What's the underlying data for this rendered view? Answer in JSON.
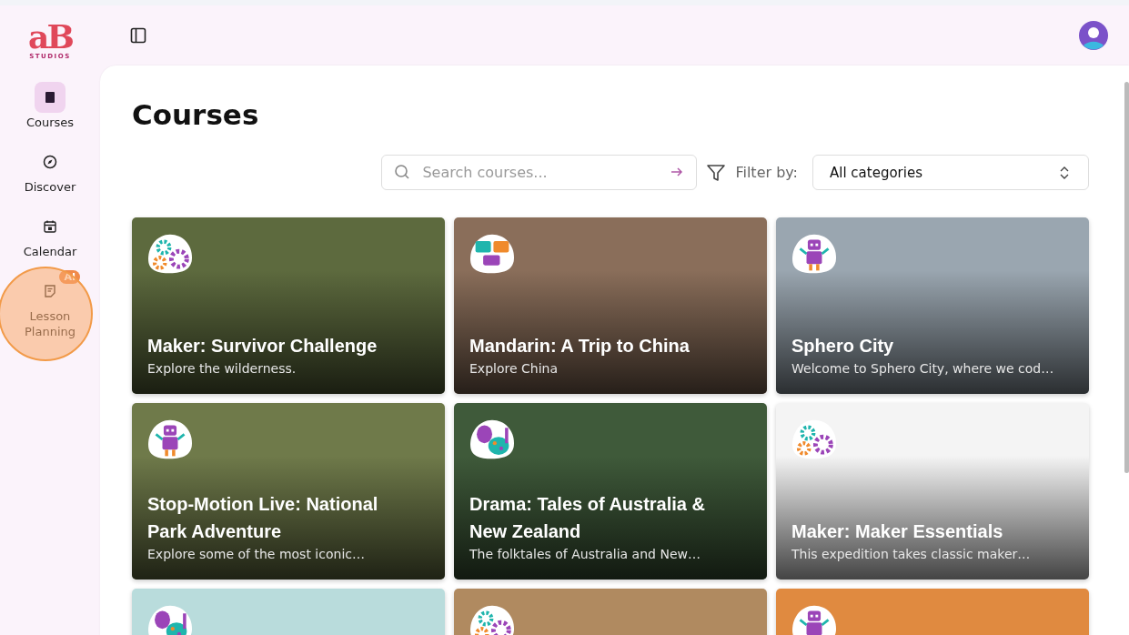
{
  "brand": {
    "logo": "aB",
    "name": "STUDIOS"
  },
  "nav": [
    {
      "label": "Courses",
      "selected": true
    },
    {
      "label": "Discover",
      "selected": false
    },
    {
      "label": "Calendar",
      "selected": false
    },
    {
      "label": "Lesson Planning",
      "selected": false,
      "badge": "AI",
      "highlighted": true
    }
  ],
  "page_title": "Courses",
  "search": {
    "placeholder": "Search courses..."
  },
  "filter": {
    "label": "Filter by:",
    "value": "All categories"
  },
  "courses": [
    {
      "title": "Maker: Survivor Challenge",
      "subtitle": "Explore the wilderness.",
      "kind": "maker"
    },
    {
      "title": "Mandarin: A Trip to China",
      "subtitle": "Explore China",
      "kind": "language"
    },
    {
      "title": "Sphero City",
      "subtitle": "Welcome to Sphero City, where we cod…",
      "kind": "coding"
    },
    {
      "title": "Stop-Motion Live: National Park Adventure",
      "subtitle": "Explore some of the most iconic…",
      "kind": "coding"
    },
    {
      "title": "Drama: Tales of Australia & New Zealand",
      "subtitle": "The folktales of Australia and New…",
      "kind": "drama"
    },
    {
      "title": "Maker: Maker Essentials",
      "subtitle": "This expedition takes classic maker…",
      "kind": "maker"
    },
    {
      "kind": "drama"
    },
    {
      "kind": "maker"
    },
    {
      "kind": "coding"
    }
  ]
}
